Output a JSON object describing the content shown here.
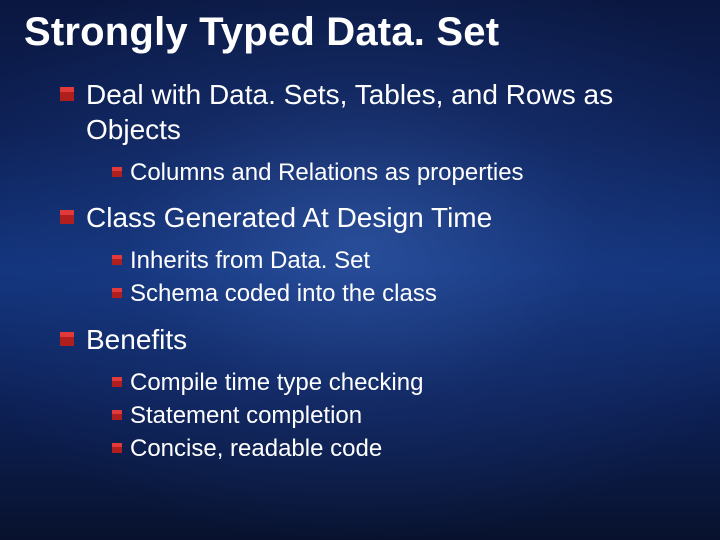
{
  "title": "Strongly Typed Data. Set",
  "items": [
    {
      "text": "Deal with Data. Sets, Tables, and Rows as Objects",
      "children": [
        {
          "text": "Columns and Relations as properties"
        }
      ]
    },
    {
      "text": "Class Generated At Design Time",
      "children": [
        {
          "text": "Inherits from Data. Set"
        },
        {
          "text": "Schema coded into the class"
        }
      ]
    },
    {
      "text": "Benefits",
      "children": [
        {
          "text": "Compile time type checking"
        },
        {
          "text": "Statement completion"
        },
        {
          "text": "Concise, readable code"
        }
      ]
    }
  ]
}
